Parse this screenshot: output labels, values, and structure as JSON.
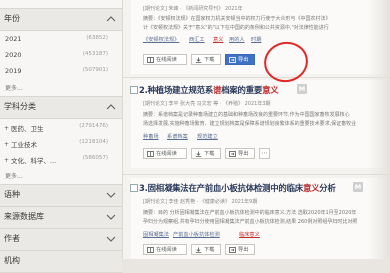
{
  "sidebar": {
    "year_title": "年份",
    "years": [
      {
        "label": "2021",
        "count": "(63852)"
      },
      {
        "label": "2020",
        "count": "(453187)"
      },
      {
        "label": "2019",
        "count": "(507901)"
      }
    ],
    "more_1": "更多...",
    "subject_title": "学科分类",
    "subjects": [
      {
        "label": "医药、卫生",
        "count": "(2791476)"
      },
      {
        "label": "工业技术",
        "count": "(1218104)"
      },
      {
        "label": "文化、科学、...",
        "count": "(586057)"
      }
    ],
    "more_2": "更多...",
    "lang_title": "语种",
    "source_title": "来源数据库",
    "author_title": "作者",
    "org_title": "机构"
  },
  "results": [
    {
      "meta": "[期刊论文]  朱峰 · 《新闻研究导刊》  2021年",
      "abstract_1": "摘要：《安顿权法规》在国家权力机关安顿当中的权力行使于大众形与《中国农村法》",
      "abstract_2": "计《安顿权法规》关于\"意义\"的\"以下在中国的的条例和公共资源中,\"对法律性能进行",
      "keywords": [
        "《安顿权法规》",
        "西汇工",
        "意义",
        "用的人",
        "时期"
      ],
      "buttons": {
        "read": "在线阅读",
        "download": "下载",
        "export": "导出"
      }
    },
    {
      "number": "2.",
      "title_prefix": "种植场建立规范系",
      "title_hl": "谱",
      "title_suffix": "档案的重要",
      "title_hl2": "意义",
      "badge": "M",
      "meta": "[期刊论文]  李平  张大亮  冯文宏  等 ·  《养殖》  2021年3期",
      "abstract_1": "摘要：系谱档案是记录种畜场建立的基础和种畜场改良的重要环节,作为中国国家畜牧发展核心",
      "abstract_2": "场选择发展,实施种畜场繁育、建立规划档案是保障系谱规划良繁体系的重要技术要求,保证畜牧业",
      "keywords": [
        "种畜场",
        "系谱档案",
        "规范建立"
      ],
      "buttons": {
        "read": "在线阅读",
        "download": "下载",
        "export": "导出"
      }
    },
    {
      "number": "3.",
      "title_prefix": "固相凝集法在产前血小板抗体检测中的临床",
      "title_hl": "意义",
      "title_suffix": "分析",
      "badge": "M",
      "meta": "[期刊论文]  李佳  赵秀艳 · 《健康必读》  2021年9期",
      "abstract_1": "摘要：目的 分析固相凝集法在产前血小板抗体检测中的临床意义.方法 选取2020年1月至2020年",
      "abstract_2": "孕妇分为观察组,共有孕妇分使用固相凝集法产前血小板抗体检测,结果 260例对照组孕妇时比对照",
      "keywords": [
        "固相凝集法",
        "产前血小板抗体检测",
        "临床意义"
      ],
      "buttons": {
        "read": "在线阅读",
        "download": "下载",
        "export": "导出"
      }
    }
  ],
  "colors": {
    "accent": "#3f72c4",
    "highlight": "#c02c2c",
    "annotation": "#e02a2a"
  }
}
